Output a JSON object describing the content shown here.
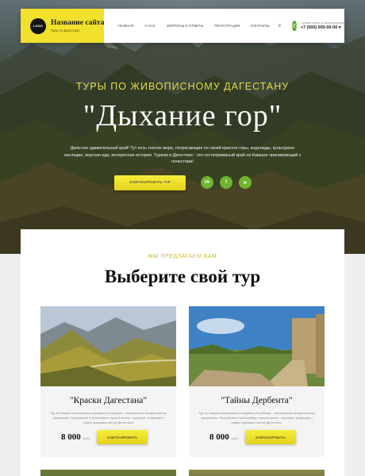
{
  "header": {
    "logo_text": "LOGO",
    "site_name": "Название сайта",
    "site_tagline": "Туры по Дагестану",
    "nav": [
      "ГЛАВНАЯ",
      "О НАС",
      "ВОПРОСЫ И ОТВЕТЫ",
      "РЕГИСТРАЦИЯ",
      "КОНТАКТЫ"
    ],
    "menu_icon": "≡",
    "phone_label": "Горячая линия по всем вопросам:",
    "phone": "+7 (000) 000-00-00 ▾"
  },
  "hero": {
    "subtitle": "ТУРЫ ПО ЖИВОПИСНОМУ ДАГЕСТАНУ",
    "title": "\"Дыхание гор\"",
    "description": "Дагестан удивительный край! Тут есть теплое море, потрясающие по своей красоте горы, водопады, культурное наследие, вкусная еда, интересная история. Туризм в Дагестане - это гостеприимный край на Кавказе принимающий с почестями!",
    "button": "ЗАБРОНИРОВАТЬ ТУР",
    "socials": [
      "vk",
      "f",
      "tg"
    ]
  },
  "offers": {
    "kicker": "МЫ ПРЕДЛАГАЕМ ВАМ",
    "title": "Выберите свой тур",
    "cards": [
      {
        "title": "\"Краски Дагестана\"",
        "description": "Тур по самым популярным локациям республики - насыщенная экскурсионная программа. Погружение в атмосферу горской жизни - культура, традиции и самые красивые места Дагестана.",
        "price": "8 000",
        "currency": "руб/с",
        "button": "ЗАБРОНИРОВАТЬ"
      },
      {
        "title": "\"Тайны Дербента\"",
        "description": "Тур по самым популярным локациям республики - насыщенная экскурсионная программа. Погружение в атмосферу горской жизни - культура, традиции и самые красивые места Дагестана.",
        "price": "8 000",
        "currency": "руб/с",
        "button": "ЗАБРОНИРОВАТЬ"
      }
    ]
  },
  "colors": {
    "accent_yellow": "#f2e12c",
    "accent_green": "#6fb42f",
    "kicker": "#c9bb36"
  }
}
